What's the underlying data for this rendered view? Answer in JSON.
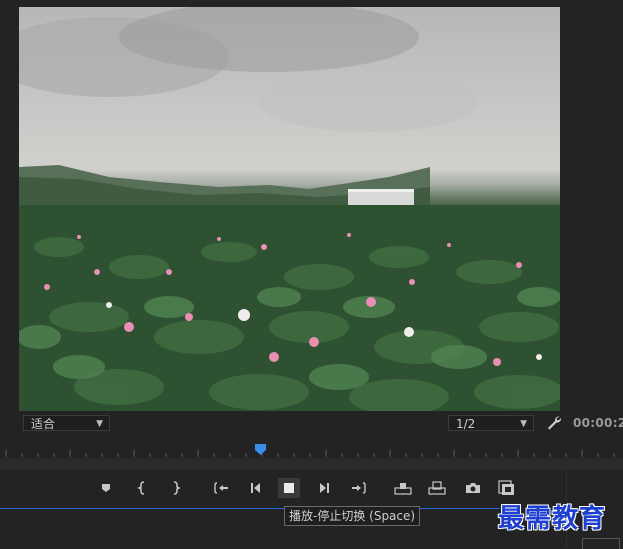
{
  "viewer": {
    "content": "lotus-field-video-frame"
  },
  "fit_dropdown": {
    "value": "适合"
  },
  "resolution_dropdown": {
    "value": "1/2"
  },
  "timecode": "00:00:2",
  "controls": [
    {
      "name": "add-marker-button",
      "icon": "marker-icon"
    },
    {
      "name": "mark-in-button",
      "icon": "mark-in-icon"
    },
    {
      "name": "mark-out-button",
      "icon": "mark-out-icon"
    },
    {
      "name": "go-to-in-button",
      "icon": "go-to-in-icon"
    },
    {
      "name": "step-back-button",
      "icon": "step-back-icon"
    },
    {
      "name": "play-stop-button",
      "icon": "stop-icon"
    },
    {
      "name": "step-forward-button",
      "icon": "step-forward-icon"
    },
    {
      "name": "go-to-out-button",
      "icon": "go-to-out-icon"
    },
    {
      "name": "insert-button",
      "icon": "insert-icon"
    },
    {
      "name": "overwrite-button",
      "icon": "overwrite-icon"
    },
    {
      "name": "export-frame-button",
      "icon": "camera-icon"
    },
    {
      "name": "button-editor-button",
      "icon": "button-editor-icon"
    }
  ],
  "tooltip": "播放-停止切换 (Space)",
  "watermark": "最需教育",
  "colors": {
    "accent": "#2a66d6",
    "playhead": "#3b8beb",
    "watermark": "#1f3fd0"
  }
}
